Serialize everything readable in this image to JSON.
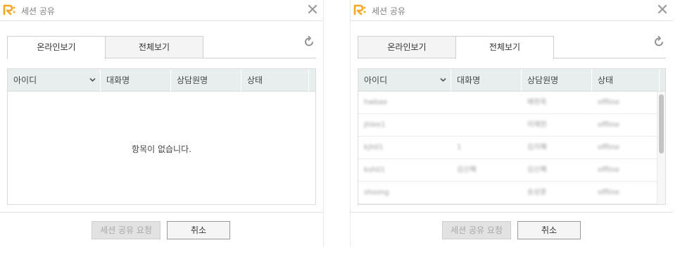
{
  "dialogs": [
    {
      "title": "세션 공유",
      "tabs": [
        "온라인보기",
        "전체보기"
      ],
      "active_tab": "온라인보기",
      "columns": [
        "아이디",
        "대화명",
        "상담원명",
        "상태"
      ],
      "empty_text": "항목이 없습니다.",
      "buttons": {
        "request": "세션 공유 요청",
        "cancel": "취소"
      }
    },
    {
      "title": "세션 공유",
      "tabs": [
        "온라인보기",
        "전체보기"
      ],
      "active_tab": "전체보기",
      "columns": [
        "아이디",
        "대화명",
        "상담원명",
        "상태"
      ],
      "rows": [
        [
          "hwbae",
          "",
          "배현욱",
          "offline"
        ],
        [
          "jhlee1",
          "",
          "이재현",
          "offline"
        ],
        [
          "kjh01",
          "1",
          "김지혜",
          "offline"
        ],
        [
          "ksh01",
          "김신혜",
          "김신혜",
          "offline"
        ],
        [
          "shsong",
          "",
          "송상훈",
          "offline"
        ]
      ],
      "buttons": {
        "request": "세션 공유 요청",
        "cancel": "취소"
      }
    }
  ],
  "colors": {
    "logo_orange": "#f5a623",
    "header_bg": "#e8eeee",
    "disabled_button_bg": "#e2e2e2"
  },
  "icons": [
    "app-logo-icon",
    "close-icon",
    "refresh-icon",
    "chevron-down-icon"
  ]
}
